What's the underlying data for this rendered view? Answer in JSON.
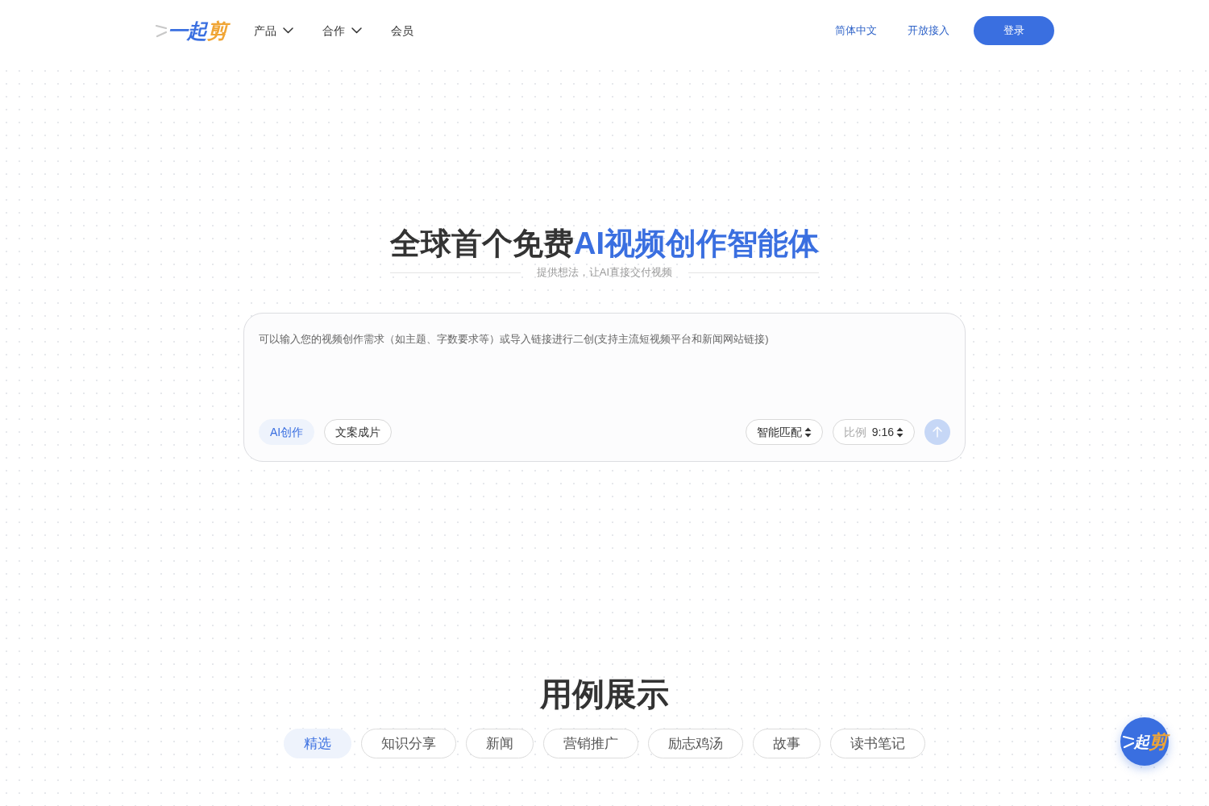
{
  "header": {
    "logo": {
      "parts": [
        {
          "text": "一起",
          "color": "#3a6fe0"
        },
        {
          "text": "剪",
          "color": "#f0a535"
        }
      ]
    },
    "nav": [
      {
        "label": "产品",
        "kind": "dropdown"
      },
      {
        "label": "合作",
        "kind": "dropdown"
      },
      {
        "label": "会员",
        "kind": "link"
      }
    ],
    "links": [
      "简体中文",
      "开放接入"
    ],
    "login_button": "登录"
  },
  "hero": {
    "title": {
      "lead": "全球首个免费",
      "highlight": "AI视频创作智能体"
    },
    "subtitle": "提供想法，让AI直接交付视频"
  },
  "composer": {
    "placeholder": "可以输入您的视频创作需求（如主题、字数要求等）或导入链接进行二创(支持主流短视频平台和新闻网站链接)",
    "modes": [
      {
        "label": "AI创作",
        "selected": true
      },
      {
        "label": "文案成片",
        "selected": false
      }
    ],
    "options": [
      {
        "label": "智能匹配"
      },
      {
        "label": "比例",
        "value": "9:16"
      }
    ],
    "send": {
      "disabled": true
    }
  },
  "showcase": {
    "title": "用例展示",
    "categories": [
      {
        "label": "精选",
        "selected": true
      },
      {
        "label": "知识分享",
        "selected": false
      },
      {
        "label": "新闻",
        "selected": false
      },
      {
        "label": "营销推广",
        "selected": false
      },
      {
        "label": "励志鸡汤",
        "selected": false
      },
      {
        "label": "故事",
        "selected": false
      },
      {
        "label": "读书笔记",
        "selected": false
      }
    ]
  },
  "floating_button": {
    "parts": [
      {
        "text": "起",
        "color": "#ffffff"
      },
      {
        "text": "剪",
        "color": "#f0a535"
      }
    ]
  }
}
